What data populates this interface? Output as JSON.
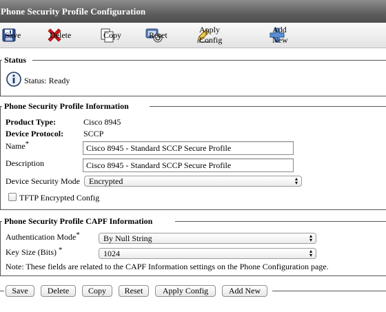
{
  "window": {
    "title": "Phone Security Profile Configuration"
  },
  "toolbar": {
    "save": "Save",
    "delete": "Delete",
    "copy": "Copy",
    "reset": "Reset",
    "apply_config": "Apply Config",
    "add_new": "Add New"
  },
  "status_section": {
    "legend": "Status",
    "status_text": "Status: Ready"
  },
  "info_section": {
    "legend": "Phone Security Profile Information",
    "product_type_label": "Product Type:",
    "product_type_value": "Cisco 8945",
    "device_protocol_label": "Device Protocol:",
    "device_protocol_value": "SCCP",
    "name_label": "Name",
    "name_value": "Cisco 8945 - Standard SCCP Secure Profile",
    "description_label": "Description",
    "description_value": "Cisco 8945 - Standard SCCP Secure Profile",
    "device_security_mode_label": "Device Security Mode",
    "device_security_mode_value": "Encrypted",
    "tftp_label": "TFTP Encrypted Config",
    "required_marker": "*"
  },
  "capf_section": {
    "legend": "Phone Security Profile CAPF Information",
    "auth_mode_label": "Authentication Mode",
    "auth_mode_value": "By Null String",
    "key_size_label": "Key Size (Bits)",
    "key_size_value": "1024",
    "note": "Note: These fields are related to the CAPF Information settings on the Phone Configuration page.",
    "required_marker": "*"
  },
  "bottom_buttons": {
    "save": "Save",
    "delete": "Delete",
    "copy": "Copy",
    "reset": "Reset",
    "apply_config": "Apply Config",
    "add_new": "Add New"
  },
  "icons": {
    "save": "floppy-disk-icon",
    "delete": "red-x-icon",
    "copy": "copy-document-icon",
    "reset": "reset-icon",
    "apply_config": "pencil-icon",
    "add_new": "blue-plus-icon",
    "info": "info-icon"
  }
}
